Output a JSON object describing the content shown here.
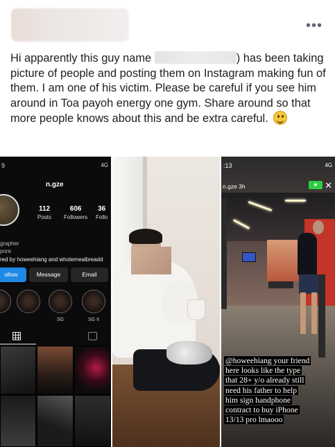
{
  "post": {
    "header": {
      "more_label": "•••"
    },
    "text_part1": "Hi apparently this guy name ",
    "text_part2": ") has been taking picture of people and posting them on Instagram making fun of them. I am one of his victim. Please be careful if you see him around in Toa payoh energy one gym.  Share around so that more people knows about this and be extra careful. "
  },
  "photo1": {
    "status_time": "9",
    "status_right": "4G",
    "username": "n.gze",
    "stats": [
      {
        "value": "112",
        "label": "Posts"
      },
      {
        "value": "606",
        "label": "Followers"
      },
      {
        "value": "36",
        "label": "Follo"
      }
    ],
    "bio_lines": [
      "grapher",
      "pore",
      "red by howeehiang and wholemealbreadd"
    ],
    "buttons": {
      "follow": "ollow",
      "message": "Message",
      "email": "Email"
    },
    "highlights": [
      {
        "label": ""
      },
      {
        "label": ""
      },
      {
        "label": "SG"
      },
      {
        "label": "SG II"
      }
    ]
  },
  "photo3": {
    "status_time": ":13",
    "status_right": "4G",
    "username": "n.gze  3h",
    "close_label": "✕",
    "caption_lines": [
      "@howeehiang your friend",
      "here looks like the type",
      "that 28+ y/o already still",
      "need his father to help",
      "him sign handphone",
      "contract to buy iPhone",
      "13/13 pro lmaooo"
    ]
  },
  "colors": {
    "text": "#1c1e21",
    "instagram_blue": "#1e88e5",
    "gym_red": "#c3342a"
  }
}
